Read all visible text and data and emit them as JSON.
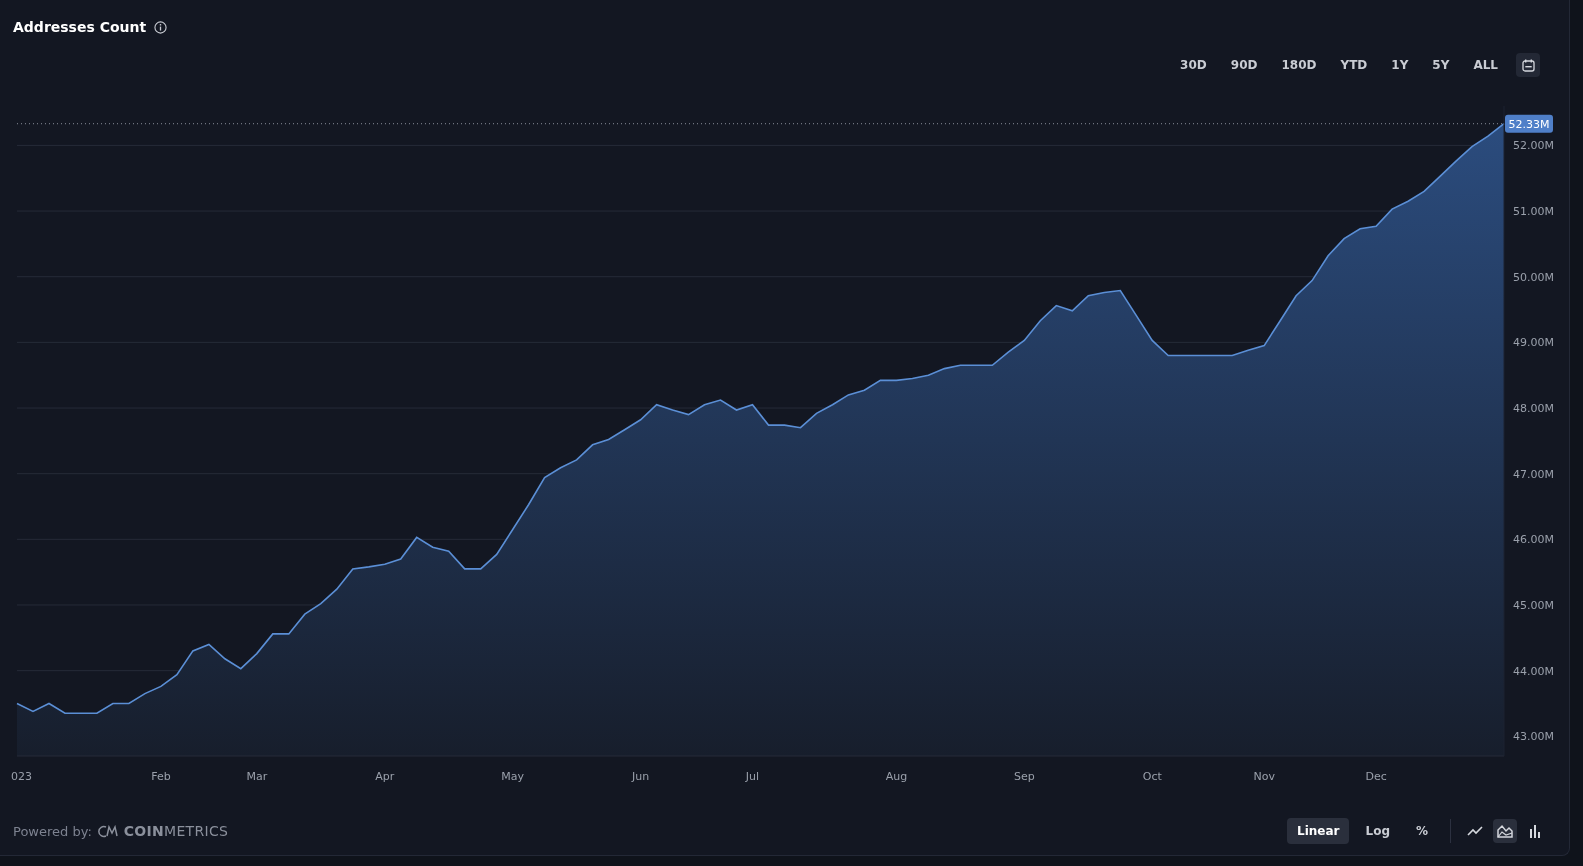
{
  "header": {
    "title": "Addresses Count"
  },
  "ranges": [
    {
      "label": "30D",
      "selected": false
    },
    {
      "label": "90D",
      "selected": false
    },
    {
      "label": "180D",
      "selected": false
    },
    {
      "label": "YTD",
      "selected": false
    },
    {
      "label": "1Y",
      "selected": false
    },
    {
      "label": "5Y",
      "selected": false
    },
    {
      "label": "ALL",
      "selected": false
    }
  ],
  "chart": {
    "chart_data": {
      "type": "area",
      "categories": [
        "023",
        null,
        null,
        null,
        null,
        null,
        null,
        null,
        null,
        "Feb",
        null,
        null,
        null,
        null,
        null,
        "Mar",
        null,
        null,
        null,
        null,
        null,
        null,
        null,
        "Apr",
        null,
        null,
        null,
        null,
        null,
        null,
        null,
        "May",
        null,
        null,
        null,
        null,
        null,
        null,
        null,
        "Jun",
        null,
        null,
        null,
        null,
        null,
        null,
        "Jul",
        null,
        null,
        null,
        null,
        null,
        null,
        null,
        null,
        "Aug",
        null,
        null,
        null,
        null,
        null,
        null,
        null,
        "Sep",
        null,
        null,
        null,
        null,
        null,
        null,
        null,
        "Oct",
        null,
        null,
        null,
        null,
        null,
        null,
        "Nov",
        null,
        null,
        null,
        null,
        null,
        null,
        "Dec",
        null,
        null,
        null,
        null,
        null,
        null,
        null,
        null
      ],
      "series": [
        {
          "color": "#5b8fd6",
          "values": [
            43.5,
            43.38,
            43.5,
            43.35,
            43.35,
            43.35,
            43.5,
            43.5,
            43.65,
            43.76,
            43.94,
            44.3,
            44.4,
            44.18,
            44.03,
            44.26,
            44.56,
            44.56,
            44.86,
            45.02,
            45.24,
            45.55,
            45.58,
            45.62,
            45.7,
            46.03,
            45.88,
            45.82,
            45.55,
            45.55,
            45.77,
            46.15,
            46.53,
            46.94,
            47.09,
            47.21,
            47.44,
            47.52,
            47.67,
            47.82,
            48.05,
            47.97,
            47.9,
            48.05,
            48.12,
            47.97,
            48.05,
            47.74,
            47.74,
            47.7,
            47.92,
            48.05,
            48.2,
            48.27,
            48.42,
            48.42,
            48.45,
            48.5,
            48.6,
            48.65,
            48.65,
            48.65,
            48.85,
            49.03,
            49.33,
            49.56,
            49.48,
            49.71,
            49.76,
            49.79,
            49.41,
            49.03,
            48.8,
            48.8,
            48.8,
            48.8,
            48.8,
            48.88,
            48.95,
            49.33,
            49.71,
            49.94,
            50.32,
            50.58,
            50.73,
            50.77,
            51.03,
            51.15,
            51.3,
            51.53,
            51.76,
            51.98,
            52.14,
            52.33
          ]
        }
      ],
      "grid": true,
      "ylim": [
        42.7,
        52.6
      ],
      "yticks": [
        {
          "value": 43,
          "label": "43.00M"
        },
        {
          "value": 44,
          "label": "44.00M"
        },
        {
          "value": 45,
          "label": "45.00M"
        },
        {
          "value": 46,
          "label": "46.00M"
        },
        {
          "value": 47,
          "label": "47.00M"
        },
        {
          "value": 48,
          "label": "48.00M"
        },
        {
          "value": 49,
          "label": "49.00M"
        },
        {
          "value": 50,
          "label": "50.00M"
        },
        {
          "value": 51,
          "label": "51.00M"
        },
        {
          "value": 52,
          "label": "52.00M"
        }
      ],
      "ref_lines": [
        {
          "axis": "y",
          "value": 52.33,
          "label": "52.33M"
        }
      ]
    }
  },
  "footer": {
    "powered_by": "Powered by:",
    "brand": "**COIN**METRICS",
    "scales": [
      {
        "label": "Linear",
        "selected": true
      },
      {
        "label": "Log",
        "selected": false
      },
      {
        "label": "%",
        "selected": false
      }
    ],
    "chart_types": [
      {
        "kind": "line",
        "selected": false
      },
      {
        "kind": "area",
        "selected": true
      },
      {
        "kind": "bar",
        "selected": false
      }
    ]
  }
}
